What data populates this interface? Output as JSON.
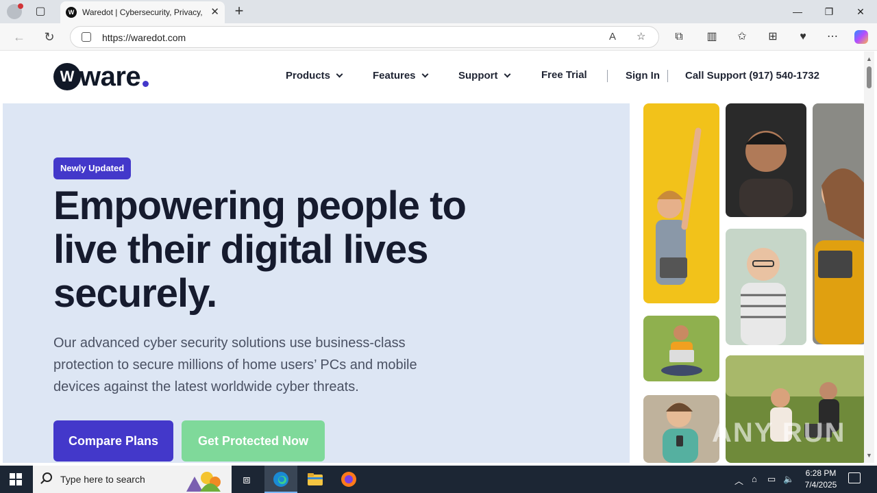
{
  "browser": {
    "tab_title": "Waredot | Cybersecurity, Privacy, I",
    "url": "https://waredot.com",
    "icons": [
      "profile-icon",
      "tab-actions-icon",
      "back-icon",
      "refresh-icon",
      "site-info-icon",
      "read-aloud-icon",
      "favorite-icon",
      "extensions-icon",
      "split-screen-icon",
      "favorites-icon",
      "collections-icon",
      "browser-essentials-icon",
      "more-icon",
      "copilot-icon"
    ]
  },
  "site": {
    "logo_text": "ware",
    "nav": {
      "products": "Products",
      "features": "Features",
      "support": "Support",
      "free_trial": "Free Trial",
      "sign_in": "Sign In",
      "call_support": "Call Support (917) 540-1732"
    },
    "hero": {
      "badge": "Newly Updated",
      "headline": "Empowering people to live their digital lives securely.",
      "subtext": "Our advanced cyber security solutions use business-class protection to secure millions of home users’ PCs and mobile devices against the latest worldwide cyber threats.",
      "cta_primary": "Compare Plans",
      "cta_secondary": "Get Protected Now"
    },
    "colors": {
      "brand": "#4338ca",
      "hero_bg": "#dde6f4",
      "secondary_cta": "#7fd99a",
      "text_dark": "#161b2e"
    }
  },
  "watermark": "ANY RUN",
  "taskbar": {
    "search_placeholder": "Type here to search",
    "time": "6:28 PM",
    "date": "7/4/2025"
  }
}
